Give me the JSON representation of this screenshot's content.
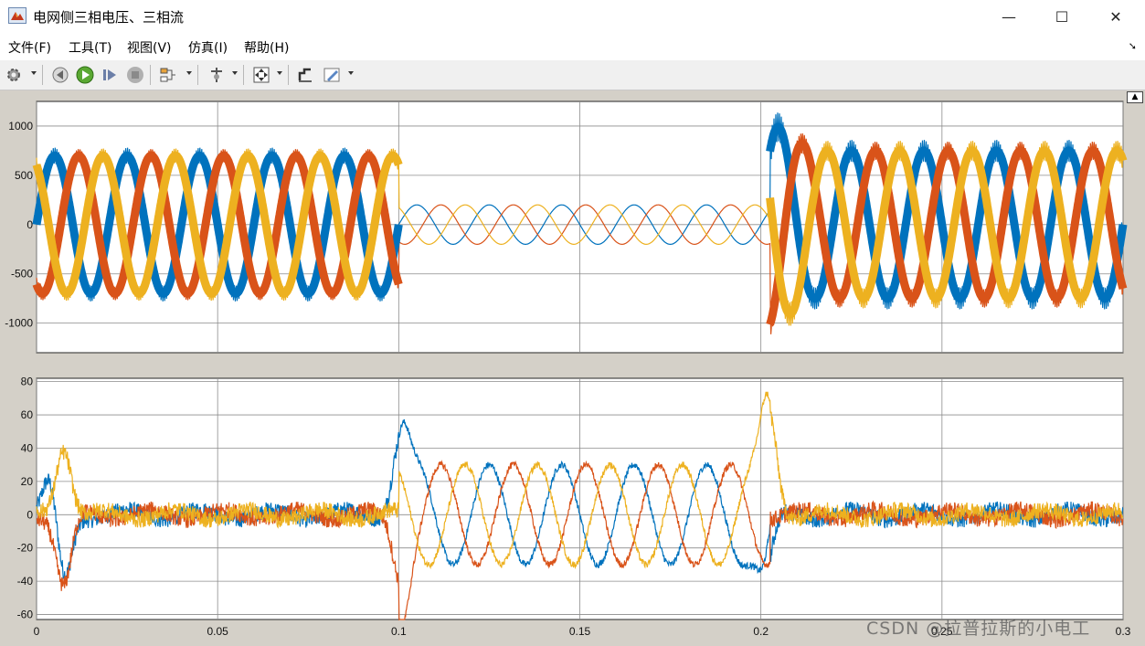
{
  "window": {
    "title": "电网侧三相电压、三相流",
    "minimize_glyph": "—",
    "maximize_glyph": "☐",
    "close_glyph": "✕"
  },
  "menu": {
    "items": [
      {
        "label": "文件(F)"
      },
      {
        "label": "工具(T)"
      },
      {
        "label": "视图(V)"
      },
      {
        "label": "仿真(I)"
      },
      {
        "label": "帮助(H)"
      }
    ]
  },
  "toolbar": {
    "icons": [
      "gear-icon",
      "rewind-step-icon",
      "run-icon",
      "step-forward-icon",
      "stop-icon",
      "signal-selector-icon",
      "cursor-measure-icon",
      "zoom-fit-icon",
      "style-icon",
      "edit-icon"
    ]
  },
  "colors": {
    "phase_a": "#0072bd",
    "phase_b": "#d95319",
    "phase_c": "#edb120",
    "axes_bg": "#ffffff",
    "grid": "#8c8c8c"
  },
  "chart_data": [
    {
      "type": "line",
      "title": "",
      "ylim": [
        -1300,
        1250
      ],
      "xlim": [
        0,
        0.3
      ],
      "y_ticks": [
        "1000",
        "500",
        "0",
        "-500",
        "-1000"
      ],
      "y_tick_values": [
        1000,
        500,
        0,
        -500,
        -1000
      ],
      "x_tick_values": [
        0,
        0.05,
        0.1,
        0.15,
        0.2,
        0.25,
        0.3
      ],
      "grid": true,
      "series_colors": [
        "#0072bd",
        "#d95319",
        "#edb120"
      ],
      "phase_segments": [
        {
          "x_start": 0,
          "x_end": 0.1,
          "amplitude": 700,
          "ripple": 80
        },
        {
          "x_start": 0.1,
          "x_end": 0.2025,
          "amplitude": 200,
          "ripple": 0
        },
        {
          "x_start": 0.2025,
          "x_end": 0.3,
          "amplitude": 750,
          "ripple": 110,
          "transient_peak": 1050
        }
      ],
      "frequency_hz": 50
    },
    {
      "type": "line",
      "title": "",
      "ylim": [
        -63,
        82
      ],
      "xlim": [
        0,
        0.3
      ],
      "y_ticks": [
        "80",
        "60",
        "40",
        "20",
        "0",
        "-20",
        "-40",
        "-60"
      ],
      "y_tick_values": [
        80,
        60,
        40,
        20,
        0,
        -20,
        -40,
        -60
      ],
      "x_ticks": [
        "0",
        "0.05",
        "0.1",
        "0.15",
        "0.2",
        "0.25",
        "0.3"
      ],
      "x_tick_values": [
        0,
        0.05,
        0.1,
        0.15,
        0.2,
        0.25,
        0.3
      ],
      "grid": true,
      "series_colors": [
        "#0072bd",
        "#d95319",
        "#edb120"
      ],
      "phase_segments": [
        {
          "x_start": 0,
          "x_end": 0.1,
          "amplitude": 3,
          "noise": 5
        },
        {
          "x_start": 0.1,
          "x_end": 0.2025,
          "amplitude": 30,
          "noise": 2
        },
        {
          "x_start": 0.2025,
          "x_end": 0.3,
          "amplitude": 3,
          "noise": 5
        }
      ],
      "transients": [
        {
          "x": 0.004,
          "y": 28
        },
        {
          "x": 0.0075,
          "y": -48
        },
        {
          "x": 0.0075,
          "y": 45
        },
        {
          "x": 0.1005,
          "y": 52
        },
        {
          "x": 0.1005,
          "y": -42
        },
        {
          "x": 0.2023,
          "y": 67
        },
        {
          "x": 0.201,
          "y": -41
        }
      ],
      "frequency_hz": 50
    }
  ],
  "watermark": "CSDN @拉普拉斯的小电工"
}
